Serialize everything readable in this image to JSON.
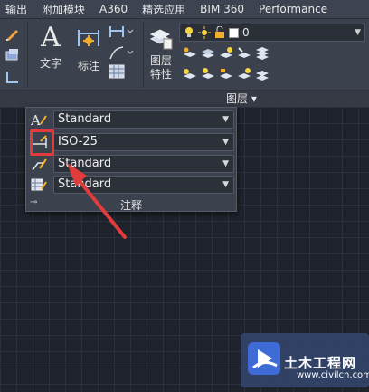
{
  "menu_tabs": [
    "输出",
    "附加模块",
    "A360",
    "精选应用",
    "BIM 360",
    "Performance"
  ],
  "ribbon": {
    "text_button_label": "文字",
    "dimension_button_label": "标注",
    "layer_properties_label_line1": "图层",
    "layer_properties_label_line2": "特性",
    "layer_combo_value": "0",
    "layers_group_label": "图层 ▾"
  },
  "annotation_panel": {
    "rows": [
      {
        "icon": "text-style-icon",
        "value": "Standard"
      },
      {
        "icon": "dimension-style-icon",
        "value": "ISO-25"
      },
      {
        "icon": "multileader-style-icon",
        "value": "Standard"
      },
      {
        "icon": "table-style-icon",
        "value": "Standard"
      }
    ],
    "footer_label": "注释"
  },
  "watermark": {
    "name": "土木工程网",
    "url": "www.civilcn.com"
  },
  "colors": {
    "highlight": "#e23b3b",
    "arrow": "#e23b3b",
    "ribbon_bg": "#3b414d",
    "canvas_bg": "#1e222a"
  }
}
